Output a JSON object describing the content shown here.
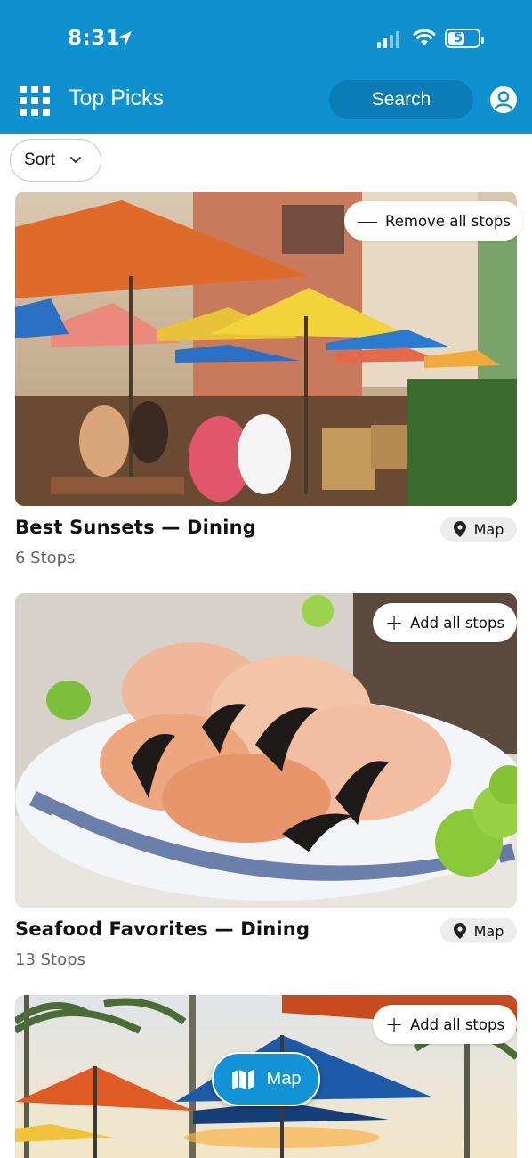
{
  "status_bar": {
    "time": "8:31",
    "battery": "51"
  },
  "header": {
    "title": "Top Picks",
    "search_label": "Search"
  },
  "sort": {
    "label": "Sort"
  },
  "cards": [
    {
      "title": "Best Sunsets — Dining",
      "stops": "6 Stops",
      "stop_action": "Remove all stops",
      "stop_action_symbol": "—",
      "map_label": "Map"
    },
    {
      "title": "Seafood Favorites — Dining",
      "stops": "13 Stops",
      "stop_action": "Add all stops",
      "stop_action_symbol": "+",
      "map_label": "Map"
    },
    {
      "stop_action": "Add all stops",
      "stop_action_symbol": "+"
    }
  ],
  "floating_map": {
    "label": "Map"
  },
  "colors": {
    "header_bg": "#0f91cf",
    "search_bg": "#0b7cb5",
    "map_fab": "#1293d6"
  },
  "icons": [
    "location-arrow-icon",
    "signal-icon",
    "wifi-icon",
    "battery-icon",
    "grid-menu-icon",
    "profile-icon",
    "chevron-down-icon",
    "map-pin-icon",
    "map-icon"
  ]
}
